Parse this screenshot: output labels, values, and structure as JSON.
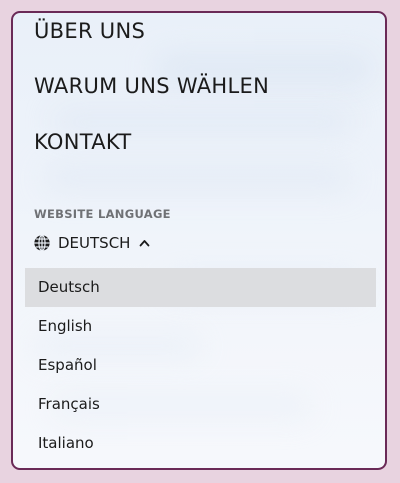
{
  "nav": {
    "items": [
      {
        "label": "ÜBER UNS"
      },
      {
        "label": "WARUM UNS WÄHLEN"
      },
      {
        "label": "KONTAKT"
      }
    ]
  },
  "language": {
    "section_label": "WEBSITE LANGUAGE",
    "current": "DEUTSCH",
    "globe_icon": "globe-icon",
    "chevron_icon": "chevron-up-icon",
    "options": [
      {
        "label": "Deutsch",
        "selected": true
      },
      {
        "label": "English"
      },
      {
        "label": "Español"
      },
      {
        "label": "Français"
      },
      {
        "label": "Italiano"
      }
    ]
  },
  "colors": {
    "page_bg": "#e8d3e0",
    "panel_border": "#6a2a57",
    "selected_bg": "#dcdde0"
  }
}
